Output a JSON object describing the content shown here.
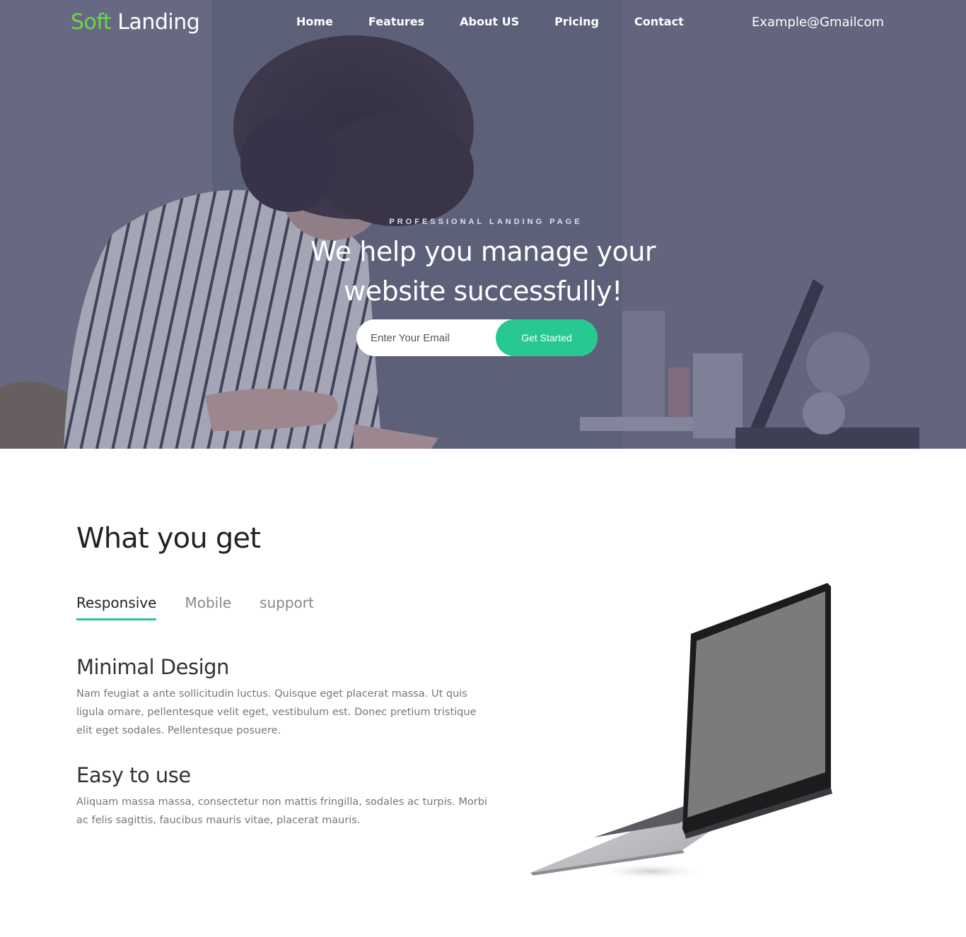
{
  "brand": {
    "part1": "Soft",
    "part2": "Landing"
  },
  "nav": {
    "items": [
      {
        "label": "Home"
      },
      {
        "label": "Features"
      },
      {
        "label": "About US"
      },
      {
        "label": "Pricing"
      },
      {
        "label": "Contact"
      }
    ],
    "email": "Example@Gmailcom"
  },
  "hero": {
    "eyebrow": "PROFESSIONAL LANDING PAGE",
    "headline_line1": "We help you manage your",
    "headline_line2": "website successfully!",
    "email_placeholder": "Enter Your Email",
    "cta_label": "Get Started"
  },
  "features": {
    "title": "What you get",
    "tabs": [
      {
        "label": "Responsive",
        "active": true
      },
      {
        "label": "Mobile",
        "active": false
      },
      {
        "label": "support",
        "active": false
      }
    ],
    "items": [
      {
        "title": "Minimal Design",
        "body": "Nam feugiat a ante sollicitudin luctus. Quisque eget placerat massa. Ut quis ligula ornare, pellentesque velit eget, vestibulum est. Donec pretium tristique elit eget sodales. Pellentesque posuere."
      },
      {
        "title": "Easy to use",
        "body": "Aliquam massa massa, consectetur non mattis fringilla, sodales ac turpis. Morbi ac felis sagittis, faucibus mauris vitae, placerat mauris."
      }
    ]
  },
  "colors": {
    "accent_green": "#27c990",
    "logo_green": "#6ad84a",
    "hero_overlay": "#56586f"
  }
}
